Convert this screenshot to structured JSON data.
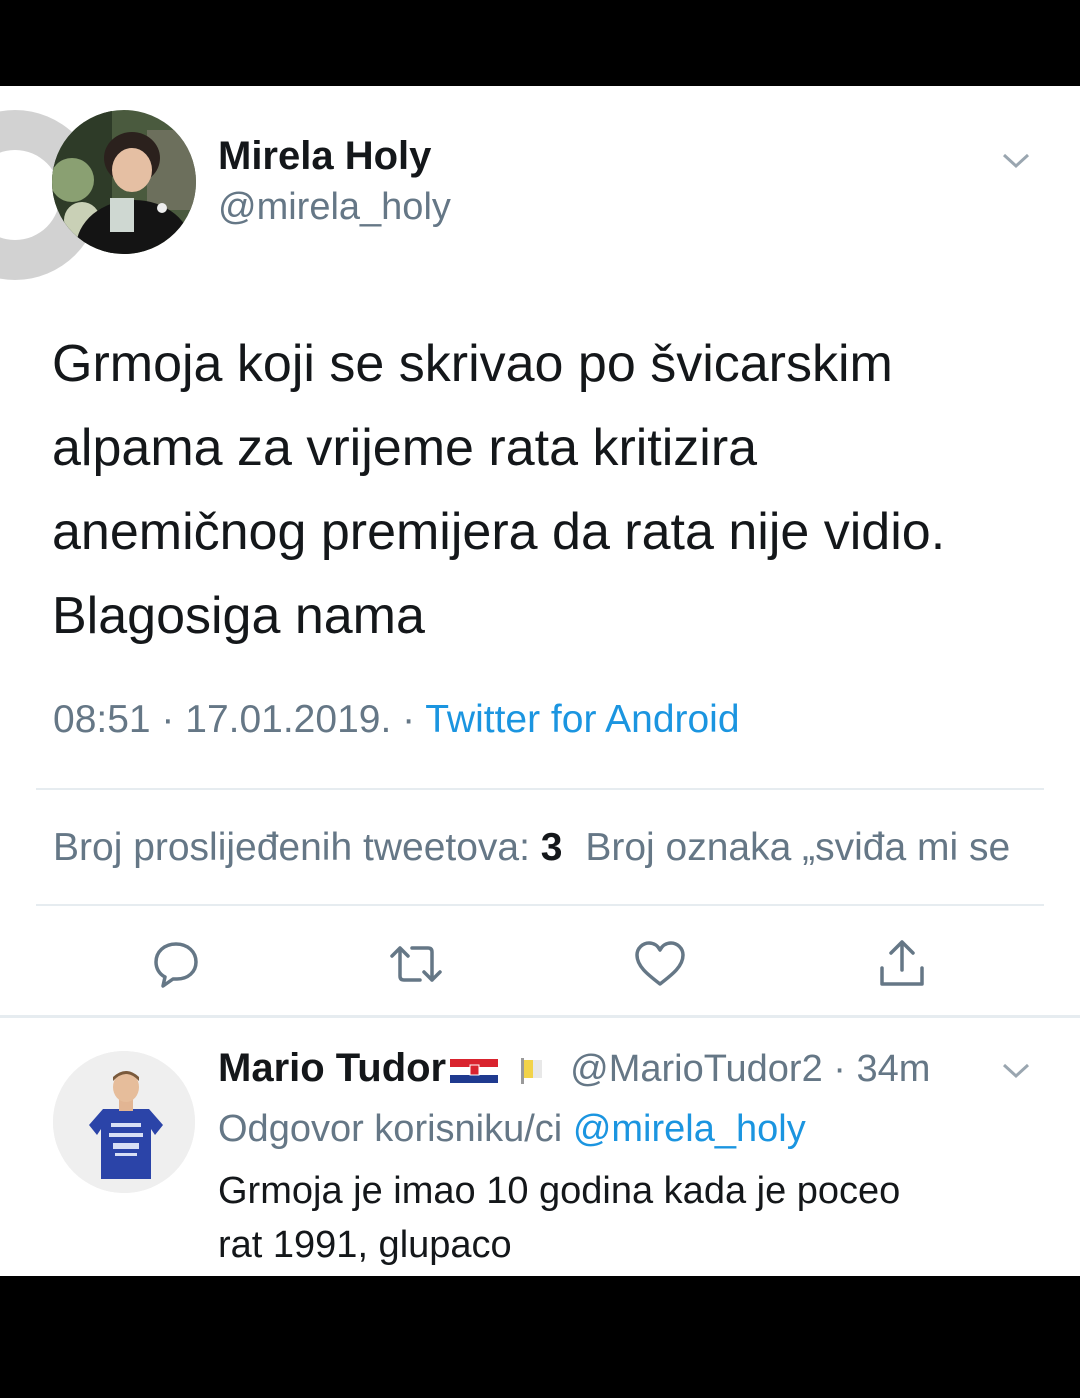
{
  "tweet": {
    "author_name": "Mirela Holy",
    "author_handle": "@mirela_holy",
    "text_lines": [
      "Grmoja koji se skrivao po švicarskim",
      "alpama za vrijeme rata kritizira",
      "anemičnog premijera da rata nije vidio.",
      "Blagosiga nama"
    ],
    "time_date": "08:51 · 17.01.2019. · ",
    "source": "Twitter for Android",
    "retweets_label": "Broj proslijeđenih tweetova:",
    "retweets_count": "3",
    "likes_label": "Broj oznaka „sviđa mi se"
  },
  "actions": {
    "reply_icon": "speech-bubble-icon",
    "retweet_icon": "retweet-icon",
    "like_icon": "heart-icon",
    "share_icon": "share-icon"
  },
  "reply": {
    "author_name": "Mario Tudor",
    "author_handle": "@MarioTudor2",
    "time": "· 34m",
    "replying_to_label": "Odgovor korisniku/ci",
    "replying_to_handle": "@mirela_holy",
    "text_lines": [
      "Grmoja je imao 10 godina kada je poceo",
      "rat 1991, glupaco"
    ]
  },
  "colors": {
    "accent": "#1b95e0",
    "secondary_text": "#657786",
    "primary_text": "#14171a",
    "divider": "#e6ecf0"
  }
}
